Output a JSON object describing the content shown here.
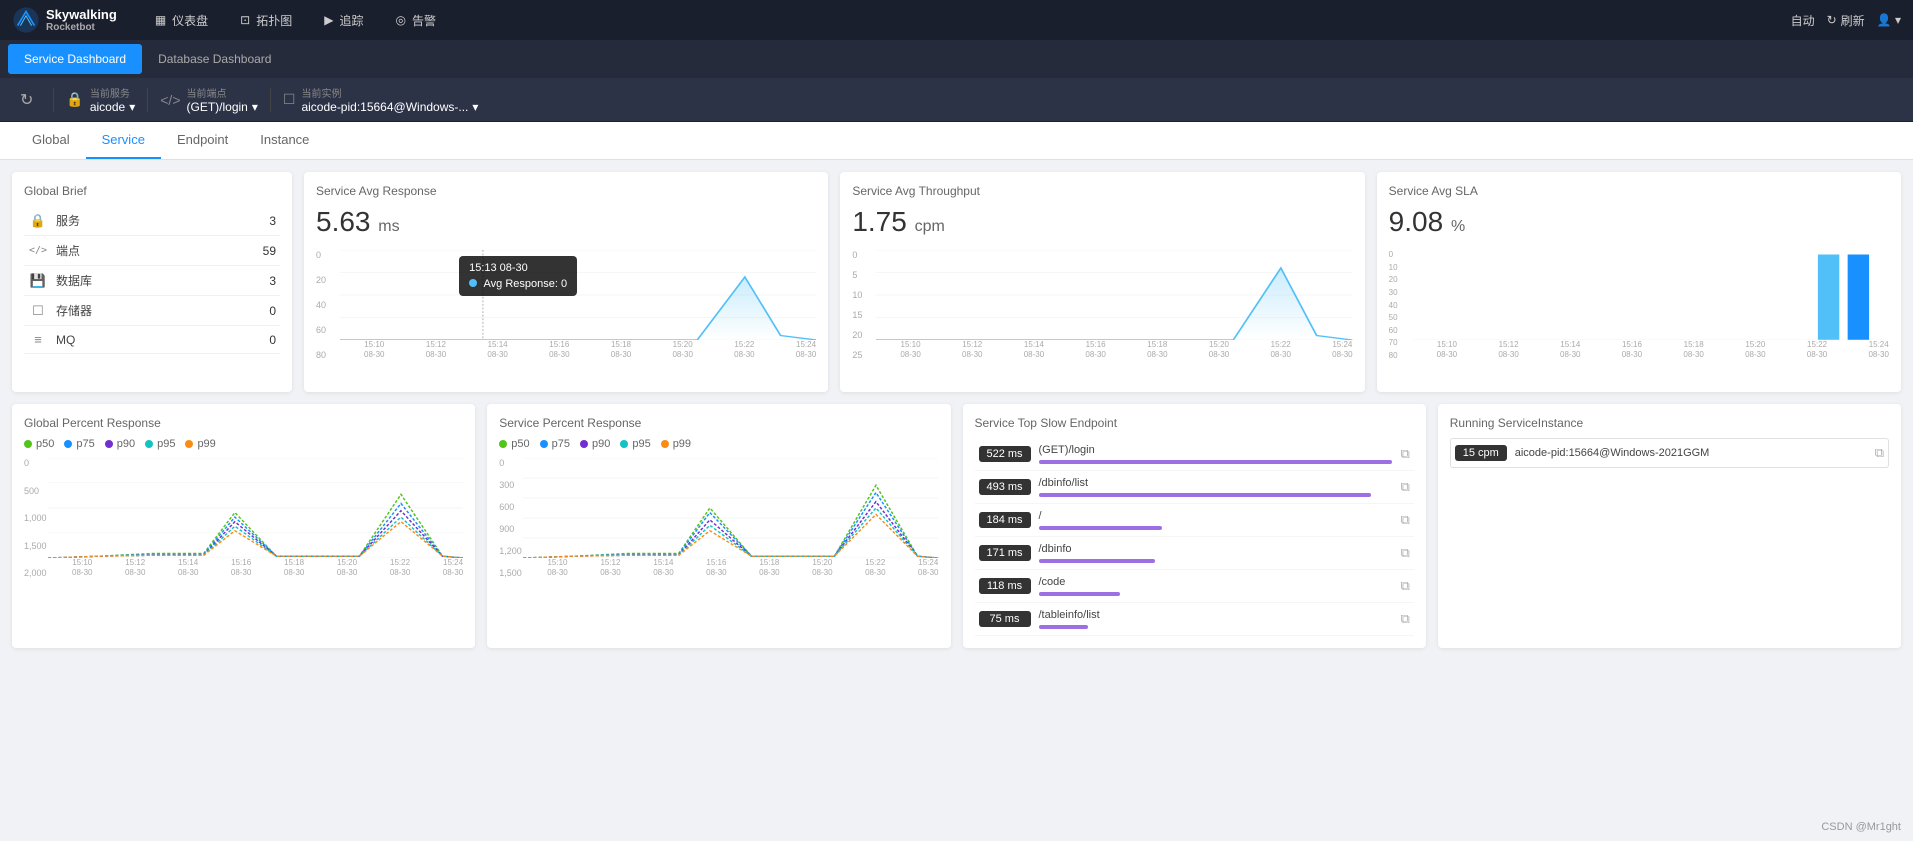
{
  "app": {
    "name": "Skywalking",
    "sub": "Rocketbot"
  },
  "topnav": {
    "items": [
      {
        "label": "仪表盘",
        "icon": "▦",
        "active": true
      },
      {
        "label": "拓扑图",
        "icon": "⊡"
      },
      {
        "label": "追踪",
        "icon": "▶"
      },
      {
        "label": "告警",
        "icon": "◎"
      }
    ],
    "right": {
      "auto_label": "自动",
      "refresh_label": "刷新",
      "user_icon": "👤"
    }
  },
  "dashboard_tabs": [
    {
      "label": "Service Dashboard",
      "active": true
    },
    {
      "label": "Database Dashboard",
      "active": false
    }
  ],
  "toolbar": {
    "refresh_icon": "↻",
    "current_service_label": "当前服务",
    "current_service_value": "aicode",
    "current_endpoint_label": "当前端点",
    "current_endpoint_value": "(GET)/login",
    "current_instance_label": "当前实例",
    "current_instance_value": "aicode-pid:15664@Windows-..."
  },
  "content_tabs": [
    {
      "label": "Global",
      "active": false
    },
    {
      "label": "Service",
      "active": true
    },
    {
      "label": "Endpoint",
      "active": false
    },
    {
      "label": "Instance",
      "active": false
    }
  ],
  "global_brief": {
    "title": "Global Brief",
    "items": [
      {
        "icon": "🔒",
        "label": "服务",
        "count": "3"
      },
      {
        "icon": "</>",
        "label": "端点",
        "count": "59"
      },
      {
        "icon": "💾",
        "label": "数据库",
        "count": "3"
      },
      {
        "icon": "☐",
        "label": "存储器",
        "count": "0"
      },
      {
        "icon": "≡",
        "label": "MQ",
        "count": "0"
      }
    ]
  },
  "service_avg_response": {
    "title": "Service Avg Response",
    "value": "5.63",
    "unit": "ms",
    "y_axis": [
      "80",
      "60",
      "40",
      "20",
      "0"
    ],
    "x_labels": [
      "15:10\n08-30",
      "15:12\n08-30",
      "15:14\n08-30",
      "15:16\n08-30",
      "15:18\n08-30",
      "15:20\n08-30",
      "15:22\n08-30",
      "15:24\n08-30"
    ],
    "tooltip_time": "15:13 08-30",
    "tooltip_label": "Avg Response: 0"
  },
  "service_avg_throughput": {
    "title": "Service Avg Throughput",
    "value": "1.75",
    "unit": "cpm",
    "y_axis": [
      "25",
      "20",
      "15",
      "10",
      "5",
      "0"
    ],
    "x_labels": [
      "15:10\n08-30",
      "15:12\n08-30",
      "15:14\n08-30",
      "15:16\n08-30",
      "15:18\n08-30",
      "15:20\n08-30",
      "15:22\n08-30",
      "15:24\n08-30"
    ]
  },
  "service_avg_sla": {
    "title": "Service Avg SLA",
    "value": "9.08",
    "unit": "%",
    "y_axis": [
      "80",
      "70",
      "60",
      "50",
      "40",
      "30",
      "20",
      "10",
      "0"
    ],
    "x_labels": [
      "15:10\n08-30",
      "15:12\n08-30",
      "15:14\n08-30",
      "15:16\n08-30",
      "15:18\n08-30",
      "15:20\n08-30",
      "15:22\n08-30",
      "15:24\n08-30"
    ]
  },
  "global_percent_response": {
    "title": "Global Percent Response",
    "legend": [
      {
        "label": "p50",
        "color": "#52c41a"
      },
      {
        "label": "p75",
        "color": "#1890ff"
      },
      {
        "label": "p90",
        "color": "#722ed1"
      },
      {
        "label": "p95",
        "color": "#13c2c2"
      },
      {
        "label": "p99",
        "color": "#fa8c16"
      }
    ],
    "y_axis": [
      "2,000",
      "1,500",
      "1,000",
      "500",
      "0"
    ],
    "x_labels": [
      "15:10\n08-30",
      "15:12\n08-30",
      "15:14\n08-30",
      "15:16\n08-30",
      "15:18\n08-30",
      "15:20\n08-30",
      "15:22\n08-30",
      "15:24\n08-30"
    ]
  },
  "service_percent_response": {
    "title": "Service Percent Response",
    "legend": [
      {
        "label": "p50",
        "color": "#52c41a"
      },
      {
        "label": "p75",
        "color": "#1890ff"
      },
      {
        "label": "p90",
        "color": "#722ed1"
      },
      {
        "label": "p95",
        "color": "#13c2c2"
      },
      {
        "label": "p99",
        "color": "#fa8c16"
      }
    ],
    "y_axis": [
      "1,500",
      "1,200",
      "900",
      "600",
      "300",
      "0"
    ],
    "x_labels": [
      "15:10\n08-30",
      "15:12\n08-30",
      "15:14\n08-30",
      "15:16\n08-30",
      "15:18\n08-30",
      "15:20\n08-30",
      "15:22\n08-30",
      "15:24\n08-30"
    ]
  },
  "slow_endpoints": {
    "title": "Service Top Slow Endpoint",
    "items": [
      {
        "ms": "522 ms",
        "path": "(GET)/login",
        "bar_width": "100%"
      },
      {
        "ms": "493 ms",
        "path": "/dbinfo/list",
        "bar_width": "94%"
      },
      {
        "ms": "184 ms",
        "path": "/",
        "bar_width": "35%"
      },
      {
        "ms": "171 ms",
        "path": "/dbinfo",
        "bar_width": "33%"
      },
      {
        "ms": "118 ms",
        "path": "/code",
        "bar_width": "23%"
      },
      {
        "ms": "75 ms",
        "path": "/tableinfo/list",
        "bar_width": "14%"
      }
    ]
  },
  "running_instances": {
    "title": "Running ServiceInstance",
    "items": [
      {
        "cpm": "15 cpm",
        "name": "aicode-pid:15664@Windows-2021GGM"
      }
    ]
  },
  "watermark": "CSDN @Mr1ght"
}
